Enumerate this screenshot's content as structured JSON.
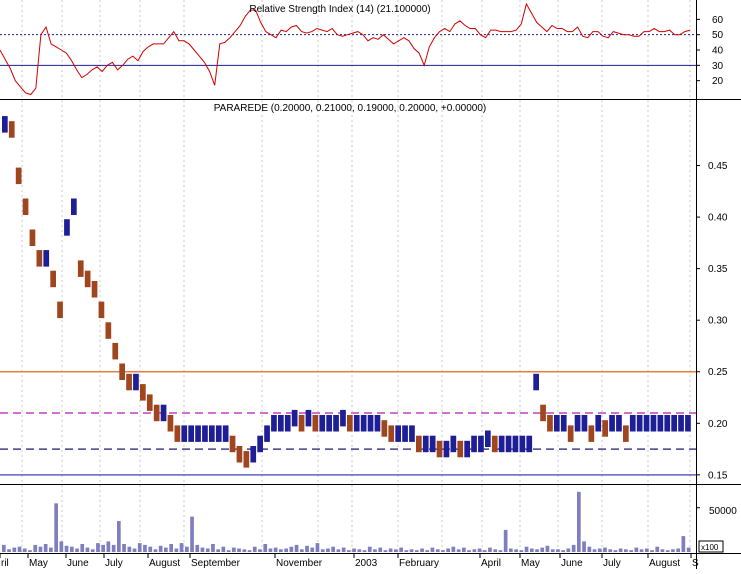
{
  "chart_data": [
    {
      "panel": "rsi",
      "type": "line",
      "title": "Relative Strength Index (14) (21.100000)",
      "yticks": [
        20,
        30,
        40,
        50,
        60
      ],
      "ylim": [
        10,
        70
      ],
      "overbought": 50,
      "oversold": 30,
      "line_color": "#d40000",
      "series": [
        {
          "values": [
            40,
            34,
            28,
            20,
            16,
            12,
            11,
            15,
            50,
            55,
            44,
            42,
            40,
            38,
            33,
            27,
            22,
            24,
            27,
            29,
            26,
            30,
            32,
            27,
            30,
            34,
            36,
            33,
            39,
            42,
            44,
            44,
            44,
            48,
            52,
            46,
            46,
            44,
            40,
            36,
            32,
            26,
            17,
            44,
            45,
            48,
            52,
            56,
            62,
            66,
            66,
            58,
            52,
            50,
            48,
            53,
            52,
            55,
            56,
            52,
            51,
            52,
            54,
            53,
            52,
            54,
            50,
            49,
            50,
            51,
            52,
            50,
            46,
            48,
            47,
            50,
            47,
            44,
            46,
            48,
            46,
            41,
            38,
            30,
            42,
            48,
            52,
            54,
            52,
            57,
            59,
            56,
            54,
            54,
            50,
            48,
            53,
            53,
            52,
            52,
            52,
            53,
            57,
            70,
            64,
            58,
            55,
            52,
            56,
            54,
            54,
            52,
            52,
            55,
            49,
            48,
            52,
            52,
            49,
            48,
            52,
            51,
            50,
            50,
            49,
            49,
            52,
            52,
            54,
            52,
            52,
            53,
            50,
            50,
            52,
            53
          ]
        }
      ]
    },
    {
      "panel": "price",
      "type": "bar",
      "title": "PARAREDE (0.20000, 0.21000, 0.19000, 0.20000, +0.00000)",
      "yticks": [
        0.15,
        0.2,
        0.25,
        0.3,
        0.35,
        0.4,
        0.45
      ],
      "ylim": [
        0.145,
        0.5
      ],
      "up_color": "#1e1e96",
      "down_color": "#a0461e",
      "lines": [
        {
          "value": 0.25,
          "style": "solid",
          "color": "#e08040"
        },
        {
          "value": 0.21,
          "style": "dashed",
          "color": "#c040c0"
        },
        {
          "value": 0.175,
          "style": "dashed",
          "color": "#40408a"
        },
        {
          "value": 0.15,
          "style": "solid",
          "color": "#6060c0"
        }
      ],
      "series": [
        {
          "values": [
            0.49,
            0.485,
            0.44,
            0.41,
            0.38,
            0.36,
            0.36,
            0.34,
            0.31,
            0.39,
            0.41,
            0.35,
            0.34,
            0.33,
            0.31,
            0.29,
            0.27,
            0.25,
            0.24,
            0.24,
            0.23,
            0.22,
            0.21,
            0.21,
            0.2,
            0.19,
            0.19,
            0.19,
            0.19,
            0.19,
            0.19,
            0.19,
            0.19,
            0.18,
            0.17,
            0.165,
            0.17,
            0.18,
            0.19,
            0.2,
            0.2,
            0.2,
            0.205,
            0.2,
            0.205,
            0.2,
            0.2,
            0.2,
            0.2,
            0.205,
            0.2,
            0.2,
            0.2,
            0.2,
            0.2,
            0.195,
            0.19,
            0.19,
            0.19,
            0.19,
            0.18,
            0.18,
            0.18,
            0.175,
            0.175,
            0.18,
            0.175,
            0.175,
            0.18,
            0.18,
            0.185,
            0.18,
            0.18,
            0.18,
            0.18,
            0.18,
            0.18,
            0.24,
            0.21,
            0.2,
            0.2,
            0.2,
            0.19,
            0.2,
            0.2,
            0.19,
            0.2,
            0.195,
            0.2,
            0.2,
            0.19,
            0.2,
            0.2,
            0.2,
            0.2,
            0.2,
            0.2,
            0.2,
            0.2,
            0.2
          ]
        }
      ]
    },
    {
      "panel": "volume",
      "type": "bar",
      "ytick_label": "50000",
      "scale_label": "x100",
      "ylim": [
        0,
        70000
      ],
      "color": "#7f7fbf",
      "series": [
        {
          "values": [
            8000,
            3000,
            5000,
            6000,
            4000,
            2000,
            8000,
            6000,
            9000,
            5000,
            55000,
            12000,
            7000,
            6000,
            4000,
            9000,
            5000,
            3000,
            10000,
            8000,
            12000,
            8000,
            35000,
            9000,
            6000,
            4000,
            10000,
            8000,
            6000,
            3000,
            7000,
            5000,
            9000,
            4000,
            10000,
            6000,
            40000,
            8000,
            5000,
            4000,
            9000,
            3000,
            6000,
            2000,
            5000,
            4000,
            3000,
            2000,
            6000,
            3000,
            9000,
            4000,
            5000,
            3000,
            4000,
            6000,
            8000,
            3000,
            7000,
            5000,
            10000,
            3000,
            4000,
            6000,
            3000,
            5000,
            2000,
            4000,
            3000,
            2000,
            6000,
            3000,
            5000,
            2000,
            4000,
            3000,
            5000,
            2000,
            3000,
            2000,
            4000,
            2000,
            5000,
            3000,
            2000,
            4000,
            6000,
            3000,
            5000,
            2000,
            3000,
            4000,
            2000,
            5000,
            3000,
            2000,
            25000,
            4000,
            3000,
            2000,
            6000,
            4000,
            3000,
            5000,
            7000,
            3000,
            3000,
            2000,
            4000,
            8000,
            68000,
            12000,
            6000,
            3000,
            4000,
            5000,
            3000,
            2000,
            4000,
            3000,
            2000,
            5000,
            3000,
            4000,
            2000,
            6000,
            3000,
            2000,
            3000,
            4000,
            18000,
            5000
          ]
        }
      ]
    }
  ],
  "x_axis_labels": [
    "ril",
    "May",
    "June",
    "July",
    "August",
    "September",
    "November",
    "2003",
    "February",
    "April",
    "May",
    "June",
    "July",
    "August",
    "S"
  ]
}
